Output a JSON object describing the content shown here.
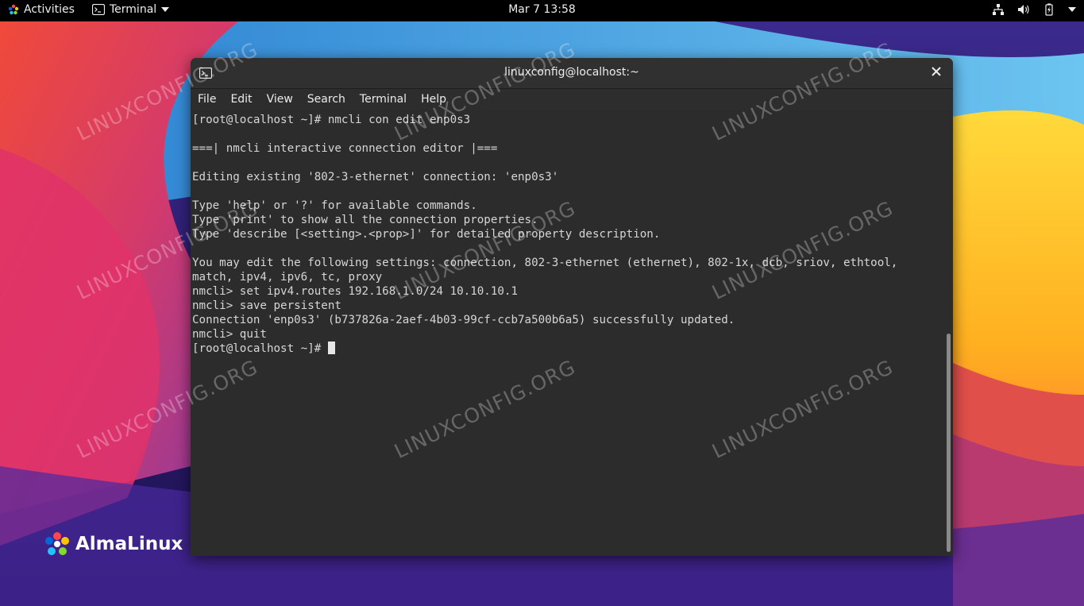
{
  "topbar": {
    "activities": "Activities",
    "app_name": "Terminal",
    "clock": "Mar 7  13:58",
    "tray_icons": [
      "network-icon",
      "volume-icon",
      "battery-icon",
      "power-menu-icon"
    ]
  },
  "window": {
    "title": "linuxconfig@localhost:~",
    "menu": [
      "File",
      "Edit",
      "View",
      "Search",
      "Terminal",
      "Help"
    ]
  },
  "terminal": {
    "lines": [
      "[root@localhost ~]# nmcli con edit enp0s3",
      "",
      "===| nmcli interactive connection editor |===",
      "",
      "Editing existing '802-3-ethernet' connection: 'enp0s3'",
      "",
      "Type 'help' or '?' for available commands.",
      "Type 'print' to show all the connection properties.",
      "Type 'describe [<setting>.<prop>]' for detailed property description.",
      "",
      "You may edit the following settings: connection, 802-3-ethernet (ethernet), 802-1x, dcb, sriov, ethtool,",
      "match, ipv4, ipv6, tc, proxy",
      "nmcli> set ipv4.routes 192.168.1.0/24 10.10.10.1",
      "nmcli> save persistent",
      "Connection 'enp0s3' (b737826a-2aef-4b03-99cf-ccb7a500b6a5) successfully updated.",
      "nmcli> quit"
    ],
    "prompt": "[root@localhost ~]# "
  },
  "logo": {
    "text": "AlmaLinux"
  },
  "watermark": "LINUXCONFIG.ORG",
  "colors": {
    "topbar": "#000000",
    "terminal_bg": "#2c2c2c",
    "terminal_fg": "#d6d6d6"
  }
}
